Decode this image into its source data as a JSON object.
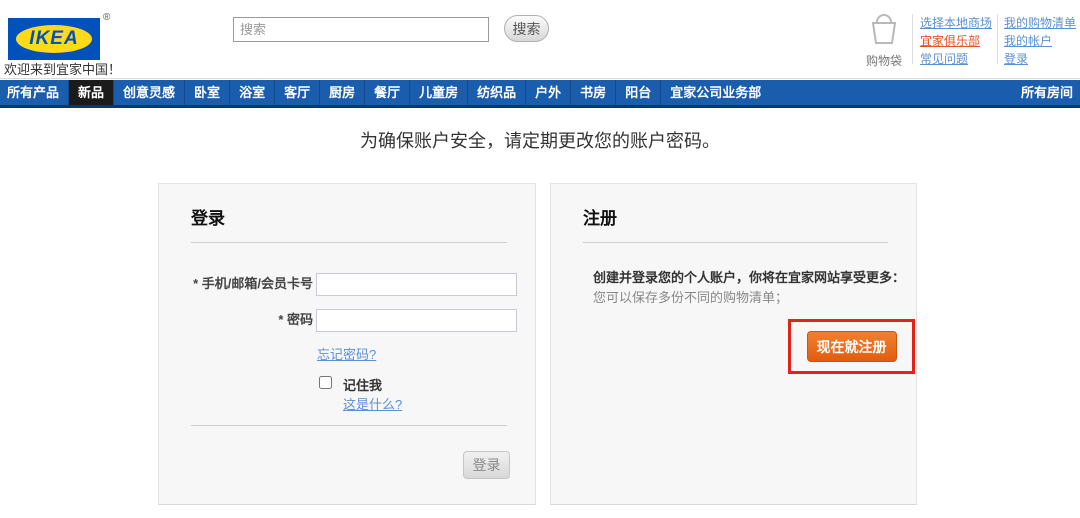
{
  "header": {
    "logo": {
      "brand": "IKEA",
      "registered_mark": "®"
    },
    "welcome": "欢迎来到宜家中国！",
    "search": {
      "placeholder": "搜索",
      "value": "",
      "button_label": "搜索"
    },
    "cart": {
      "label": "购物袋"
    },
    "links_col1": [
      {
        "label": "选择本地商场"
      },
      {
        "label": "宜家俱乐部"
      },
      {
        "label": "常见问题"
      }
    ],
    "links_col2": [
      {
        "label": "我的购物清单"
      },
      {
        "label": "我的帐户"
      },
      {
        "label": "登录"
      }
    ]
  },
  "nav": {
    "items": [
      {
        "label": "所有产品"
      },
      {
        "label": "新品"
      },
      {
        "label": "创意灵感"
      },
      {
        "label": "卧室"
      },
      {
        "label": "浴室"
      },
      {
        "label": "客厅"
      },
      {
        "label": "厨房"
      },
      {
        "label": "餐厅"
      },
      {
        "label": "儿童房"
      },
      {
        "label": "纺织品"
      },
      {
        "label": "户外"
      },
      {
        "label": "书房"
      },
      {
        "label": "阳台"
      },
      {
        "label": "宜家公司业务部"
      }
    ],
    "active_item": "新品",
    "right_item": "所有房间"
  },
  "notice": "为确保账户安全，请定期更改您的账户密码。",
  "login_card": {
    "title": "登录",
    "fields": [
      {
        "label": "* 手机/邮箱/会员卡号",
        "value": ""
      },
      {
        "label": "* 密码",
        "value": ""
      }
    ],
    "forgot_password": "忘记密码?",
    "remember_me": "记住我",
    "what_is_this": "这是什么?",
    "submit_label": "登录",
    "remember_checked": false
  },
  "register_card": {
    "title": "注册",
    "headline": "创建并登录您的个人账户，你将在宜家网站享受更多：",
    "subtext": "您可以保存多份不同的购物清单；",
    "register_button": "现在就注册"
  },
  "colors": {
    "logo_blue": "#0051ba",
    "logo_yellow": "#ffda1a",
    "nav_blue": "#1a5dad",
    "nav_strip": "#003a75",
    "nav_active_bg": "#1b1b1b",
    "link_blue": "#5b8fd6",
    "club_link_red": "#e8502d",
    "register_orange": "#e8641b",
    "annotation_red": "#e2231a",
    "card_bg": "#f7f7f8"
  }
}
